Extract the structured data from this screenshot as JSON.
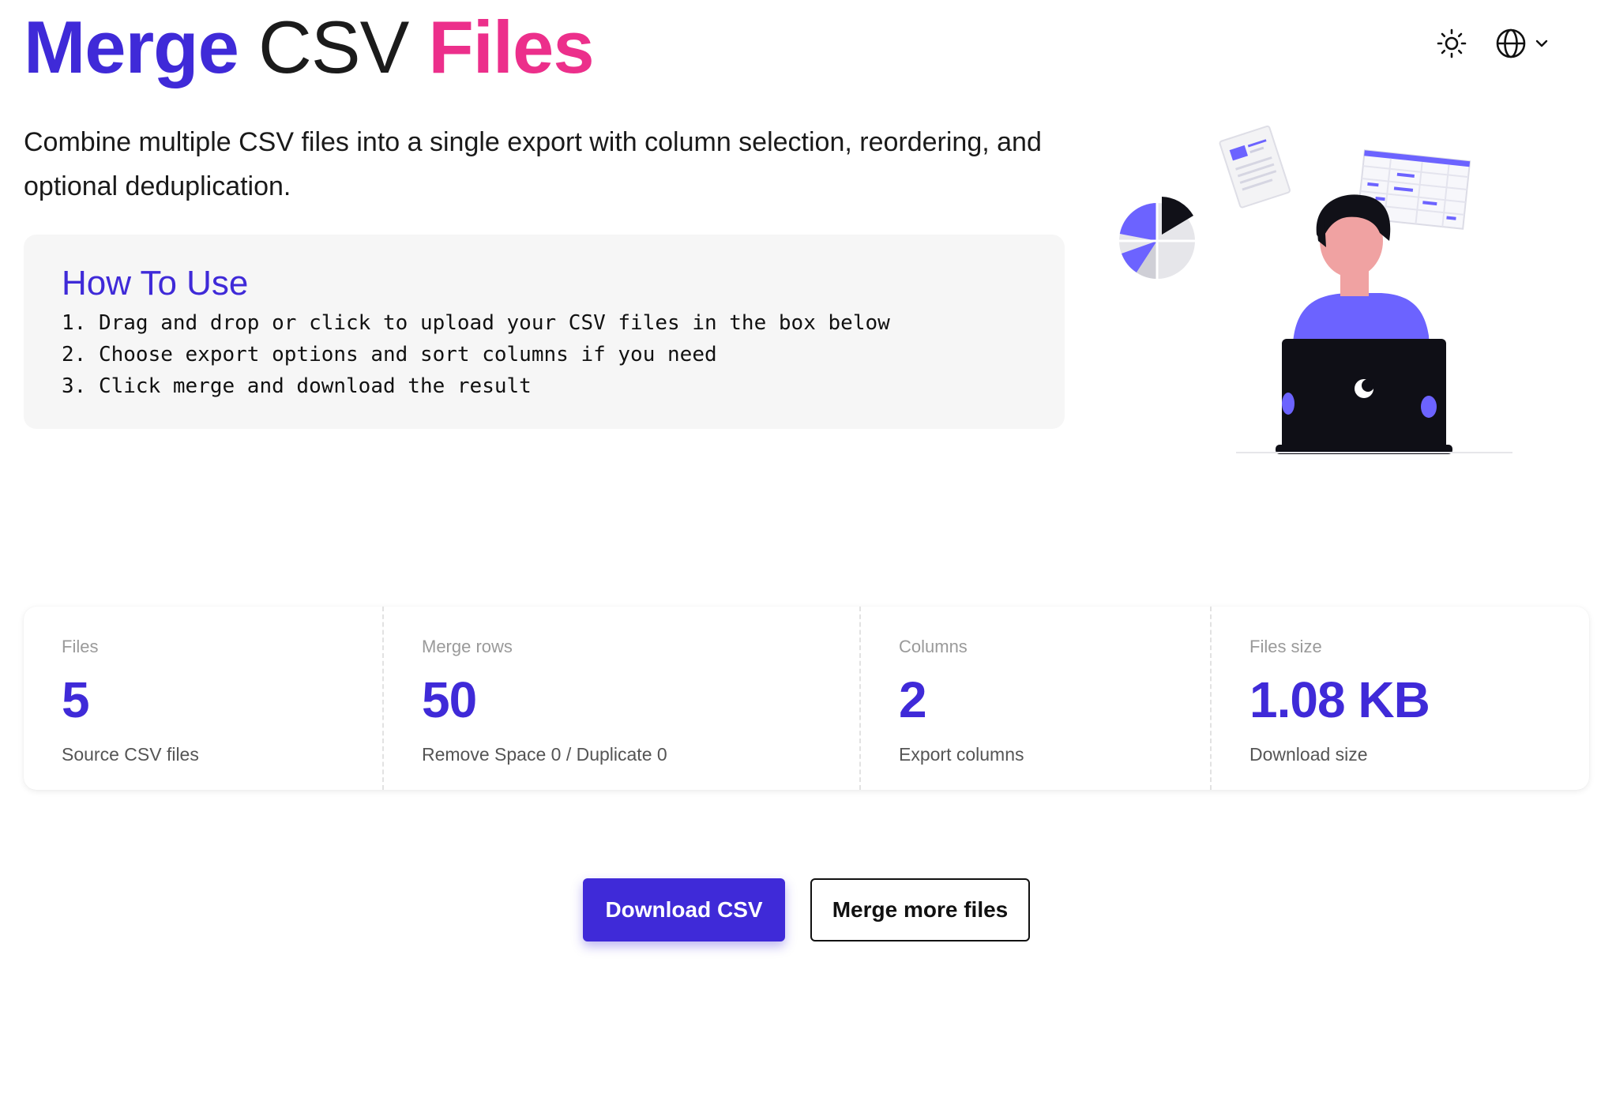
{
  "header": {
    "title_word1": "Merge",
    "title_word2": "CSV",
    "title_word3": "Files",
    "theme_toggle_icon": "sun-icon",
    "language_icon": "globe-icon",
    "language_dropdown_icon": "chevron-down-icon"
  },
  "intro": {
    "text": "Combine multiple CSV files into a single export with column selection, reordering, and optional deduplication."
  },
  "how_to": {
    "heading": "How To Use",
    "steps": [
      "1. Drag and drop or click to upload your CSV files in the box below",
      "2. Choose export options and sort columns if you need",
      "3. Click merge and download the result"
    ]
  },
  "stats": [
    {
      "label": "Files",
      "value": "5",
      "desc": "Source CSV files"
    },
    {
      "label": "Merge rows",
      "value": "50",
      "desc": "Remove Space 0 / Duplicate 0"
    },
    {
      "label": "Columns",
      "value": "2",
      "desc": "Export columns"
    },
    {
      "label": "Files size",
      "value": "1.08 KB",
      "desc": "Download size"
    }
  ],
  "actions": {
    "download_label": "Download CSV",
    "merge_more_label": "Merge more files"
  },
  "colors": {
    "accent": "#3f2ad8",
    "pink": "#ec2f8b",
    "illustration_purple": "#6c63ff"
  }
}
